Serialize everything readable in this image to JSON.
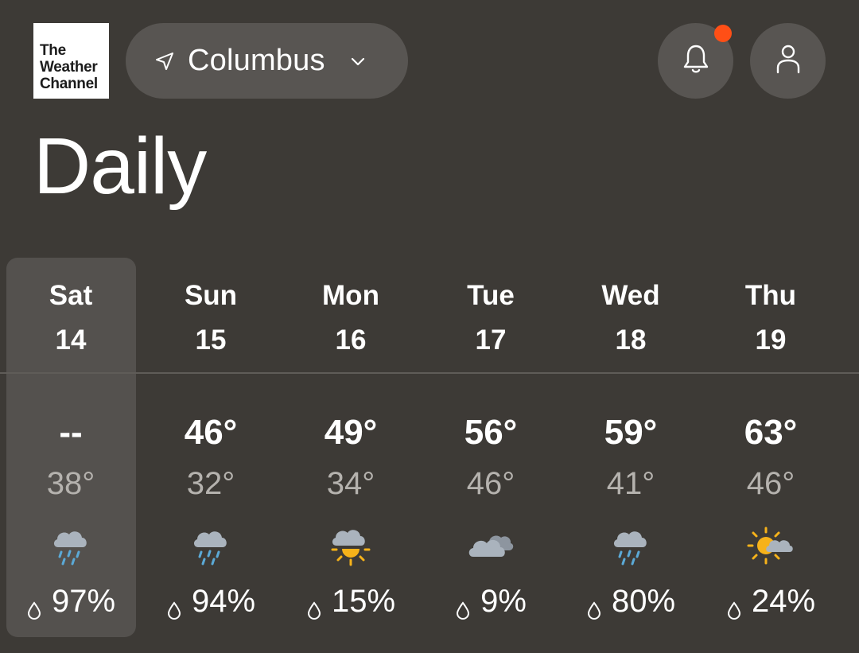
{
  "header": {
    "logo_lines": [
      "The",
      "Weather",
      "Channel"
    ],
    "location": "Columbus",
    "location_icon": "navigation-arrow-icon",
    "dropdown_icon": "chevron-down-icon",
    "notifications_icon": "bell-icon",
    "notification_badge_color": "#ff4f16",
    "profile_icon": "user-icon"
  },
  "page_title": "Daily",
  "selected_day": 0,
  "days": [
    {
      "name": "Sat",
      "date": "14",
      "high": "--",
      "low": "38°",
      "icon": "rain-icon",
      "precip": "97%"
    },
    {
      "name": "Sun",
      "date": "15",
      "high": "46°",
      "low": "32°",
      "icon": "rain-icon",
      "precip": "94%"
    },
    {
      "name": "Mon",
      "date": "16",
      "high": "49°",
      "low": "34°",
      "icon": "cloud-sun-icon",
      "precip": "15%"
    },
    {
      "name": "Tue",
      "date": "17",
      "high": "56°",
      "low": "46°",
      "icon": "cloudy-icon",
      "precip": "9%"
    },
    {
      "name": "Wed",
      "date": "18",
      "high": "59°",
      "low": "41°",
      "icon": "rain-icon",
      "precip": "80%"
    },
    {
      "name": "Thu",
      "date": "19",
      "high": "63°",
      "low": "46°",
      "icon": "partly-cloudy-icon",
      "precip": "24%"
    }
  ],
  "colors": {
    "background": "#3d3a36",
    "pill": "#585552",
    "selected": "#54514e",
    "low_temp": "#b5b2ae",
    "cloud": "#aab3bd",
    "rain": "#5ba9d6",
    "sun": "#f6b21a"
  }
}
